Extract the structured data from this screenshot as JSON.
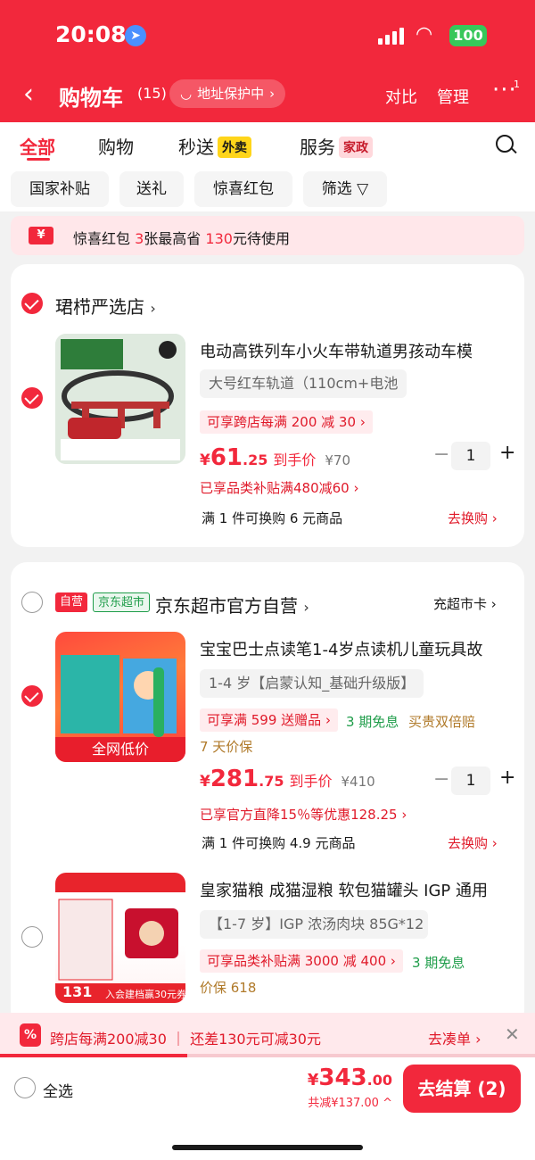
{
  "status_bar": {
    "time": "20:08",
    "battery": "100"
  },
  "header": {
    "title": "购物车",
    "count": "(15)",
    "address_label": "地址保护中",
    "compare": "对比",
    "manage": "管理",
    "more_badge": "1"
  },
  "tabs": [
    {
      "label": "全部",
      "badge": ""
    },
    {
      "label": "购物",
      "badge": ""
    },
    {
      "label": "秒送",
      "badge": "外卖"
    },
    {
      "label": "服务",
      "badge": "家政"
    }
  ],
  "filters": [
    "国家补贴",
    "送礼",
    "惊喜红包",
    "筛选"
  ],
  "coupon": {
    "icon": "¥",
    "text_a": "惊喜红包",
    "count": "3",
    "text_b": "张最高省",
    "amount": "130",
    "text_c": "元待使用"
  },
  "shop1": {
    "name": "珺栉严选店",
    "item": {
      "title": "电动高铁列车小火车带轨道男孩动车模",
      "spec": "大号红车轨道（110cm+电池",
      "promo": "可享跨店每满 200 减 30",
      "price_currency": "¥",
      "price_int": "61",
      "price_dec": ".25",
      "price_label": "到手价",
      "orig_price": "¥70",
      "subsidy": "已享品类补贴满480减60",
      "swap": "满 1 件可换购 6 元商品",
      "swap_link": "去换购",
      "qty": "1"
    }
  },
  "shop2": {
    "tag_self": "自营",
    "tag_market": "京东超市",
    "name": "京东超市官方自营",
    "card_link": "充超市卡",
    "item1": {
      "title": "宝宝巴士点读笔1-4岁点读机儿童玩具故",
      "spec": "1-4 岁【启蒙认知_基础升级版】",
      "promo": "可享满 599 送赠品",
      "tag1": "3 期免息",
      "tag2": "买贵双倍赔",
      "tag3": "7 天价保",
      "thumb_caption": "全网低价",
      "price_currency": "¥",
      "price_int": "281",
      "price_dec": ".75",
      "price_label": "到手价",
      "orig_price": "¥410",
      "subsidy": "已享官方直降15％等优惠128.25",
      "swap": "满 1 件可换购 4.9 元商品",
      "swap_link": "去换购",
      "qty": "1"
    },
    "item2": {
      "title": "皇家猫粮 成猫湿粮 软包猫罐头 IGP 通用",
      "spec": "【1-7 岁】IGP 浓汤肉块 85G*12",
      "promo": "可享品类补贴满 3000 减 400",
      "tag1": "3 期免息",
      "tag2": "价保 618",
      "thumb_price": "131",
      "thumb_caption": "入会建档赢30元券"
    }
  },
  "promo_bar": {
    "icon": "%",
    "text": "跨店每满200减30 ｜ 还差130元可减30元",
    "link": "去凑单",
    "progress": 0.35
  },
  "checkout": {
    "select_all": "全选",
    "total_currency": "¥",
    "total_int": "343",
    "total_dec": ".00",
    "saved": "共减¥137.00",
    "button": "去结算 (2)"
  },
  "colors": {
    "accent": "#f2283c",
    "green": "#1f9d4a"
  }
}
